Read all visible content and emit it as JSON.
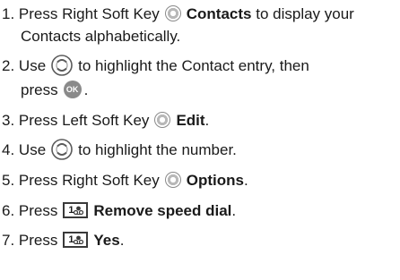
{
  "icons": {
    "soft_key": "soft-key-circle-icon",
    "nav_key": "navigation-key-icon",
    "ok_key": "ok-key-icon",
    "key_one": "number-key-1-voicemail-icon"
  },
  "ok_label": "OK",
  "key_one_digit": "1",
  "steps": [
    {
      "num": "1.",
      "pre": "Press Right Soft Key",
      "bold": "Contacts",
      "post": "to display your",
      "cont": "Contacts alphabetically."
    },
    {
      "num": "2.",
      "pre": "Use",
      "post": "to highlight the Contact entry, then",
      "cont": "press",
      "cont_post": "."
    },
    {
      "num": "3.",
      "pre": "Press Left Soft Key",
      "bold": "Edit",
      "post": "."
    },
    {
      "num": "4.",
      "pre": "Use",
      "post": "to highlight the number."
    },
    {
      "num": "5.",
      "pre": "Press Right Soft Key",
      "bold": "Options",
      "post": "."
    },
    {
      "num": "6.",
      "pre": "Press",
      "bold": "Remove speed dial",
      "post": "."
    },
    {
      "num": "7.",
      "pre": "Press",
      "bold": "Yes",
      "post": "."
    }
  ]
}
